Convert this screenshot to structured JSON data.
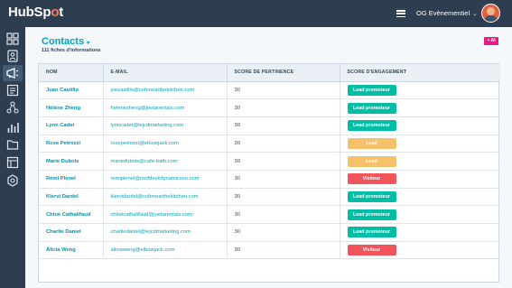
{
  "app": {
    "brand": {
      "prefix": "HubSp",
      "dot": "o",
      "suffix": "t"
    },
    "account_name": "OG Evènementiel",
    "account_chevron": "⌄"
  },
  "page": {
    "title": "Contacts",
    "title_caret": "▾",
    "subtitle": "111 fiches d'informations",
    "ai_button": "+ AI"
  },
  "table": {
    "headers": [
      "NOM",
      "E-MAIL",
      "SCORE DE PERTINENCE",
      "SCORE D'ENGAGEMENT"
    ],
    "rows": [
      {
        "name": "Juan Castillo",
        "email": "joecastillo@cofenearthekitchen.com",
        "score": "30",
        "engagement": "Lead promoteur"
      },
      {
        "name": "Hélène Zheng",
        "email": "helenezheng@joetarentals.com",
        "score": "30",
        "engagement": "Lead promoteur"
      },
      {
        "name": "Lynn Cadet",
        "email": "lynncadet@lejcdmarketing.com",
        "score": "30",
        "engagement": "Lead promoteur"
      },
      {
        "name": "Rose Petrozzi",
        "email": "rosepetrozzi@elbowjack.com",
        "score": "30",
        "engagement": "Lead"
      },
      {
        "name": "Marie Dubois",
        "email": "mariedubois@cafe-bath.com",
        "score": "30",
        "engagement": "Lead"
      },
      {
        "name": "Rémi Plenel",
        "email": "remiplenel@roofdeckdynamicsco.com",
        "score": "30",
        "engagement": "Visiteur"
      },
      {
        "name": "Klervi Dardel",
        "email": "klervidardel@cofenearthekitchen.com",
        "score": "30",
        "engagement": "Lead promoteur"
      },
      {
        "name": "Chloé Cathalifaud",
        "email": "chloécathalifaud@joetarentals.com",
        "score": "30",
        "engagement": "Lead promoteur"
      },
      {
        "name": "Charlie Daniel",
        "email": "charliedaniel@lejcdmarketing.com",
        "score": "30",
        "engagement": "Lead promoteur"
      },
      {
        "name": "Alicia Weng",
        "email": "aliciaweng@elbowjack.com",
        "score": "30",
        "engagement": "Visiteur"
      }
    ]
  },
  "badge_colors": {
    "Lead promoteur": "#00bda5",
    "Lead": "#f5c26b",
    "Visiteur": "#f2545b"
  },
  "sidebar": {
    "icons": [
      "grid-icon",
      "contact-card-icon",
      "megaphone-icon",
      "document-icon",
      "workflow-icon",
      "bar-chart-icon",
      "folder-icon",
      "layout-icon",
      "settings-icon"
    ],
    "active_index": 2
  }
}
